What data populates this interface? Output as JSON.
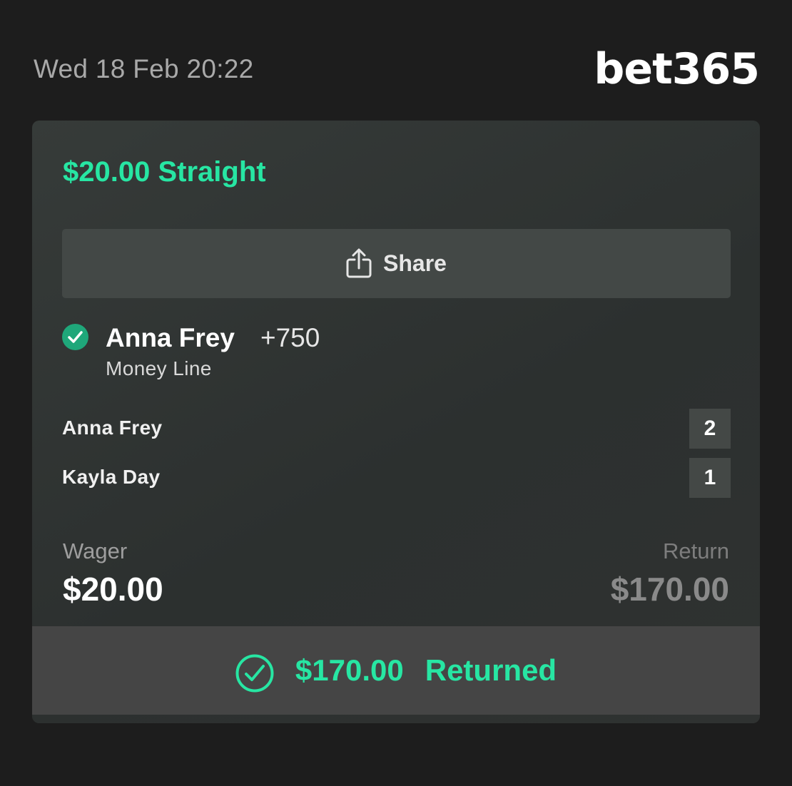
{
  "header": {
    "datetime": "Wed 18 Feb 20:22",
    "brand": "bet365"
  },
  "bet": {
    "title": "$20.00 Straight",
    "share_label": "Share",
    "selection": {
      "name": "Anna Frey",
      "odds": "+750",
      "market": "Money Line",
      "status_icon": "check-circle-icon"
    },
    "scores": [
      {
        "player": "Anna Frey",
        "score": "2"
      },
      {
        "player": "Kayla Day",
        "score": "1"
      }
    ],
    "wager_label": "Wager",
    "wager_value": "$20.00",
    "return_label": "Return",
    "return_value": "$170.00",
    "result_amount": "$170.00",
    "result_text": "Returned"
  },
  "colors": {
    "accent": "#27e6a3",
    "background": "#1d1d1d",
    "card": "#333735",
    "button": "#434846",
    "result_bar": "#454545"
  }
}
